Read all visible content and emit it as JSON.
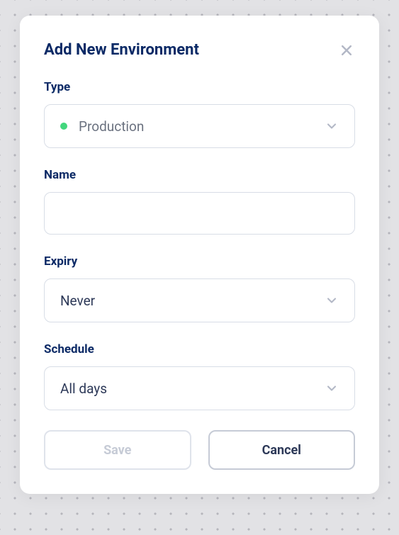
{
  "modal": {
    "title": "Add New Environment",
    "fields": {
      "type": {
        "label": "Type",
        "value": "Production",
        "status_color": "#42d77d"
      },
      "name": {
        "label": "Name",
        "value": ""
      },
      "expiry": {
        "label": "Expiry",
        "value": "Never"
      },
      "schedule": {
        "label": "Schedule",
        "value": "All days"
      }
    },
    "buttons": {
      "save": "Save",
      "cancel": "Cancel"
    }
  }
}
